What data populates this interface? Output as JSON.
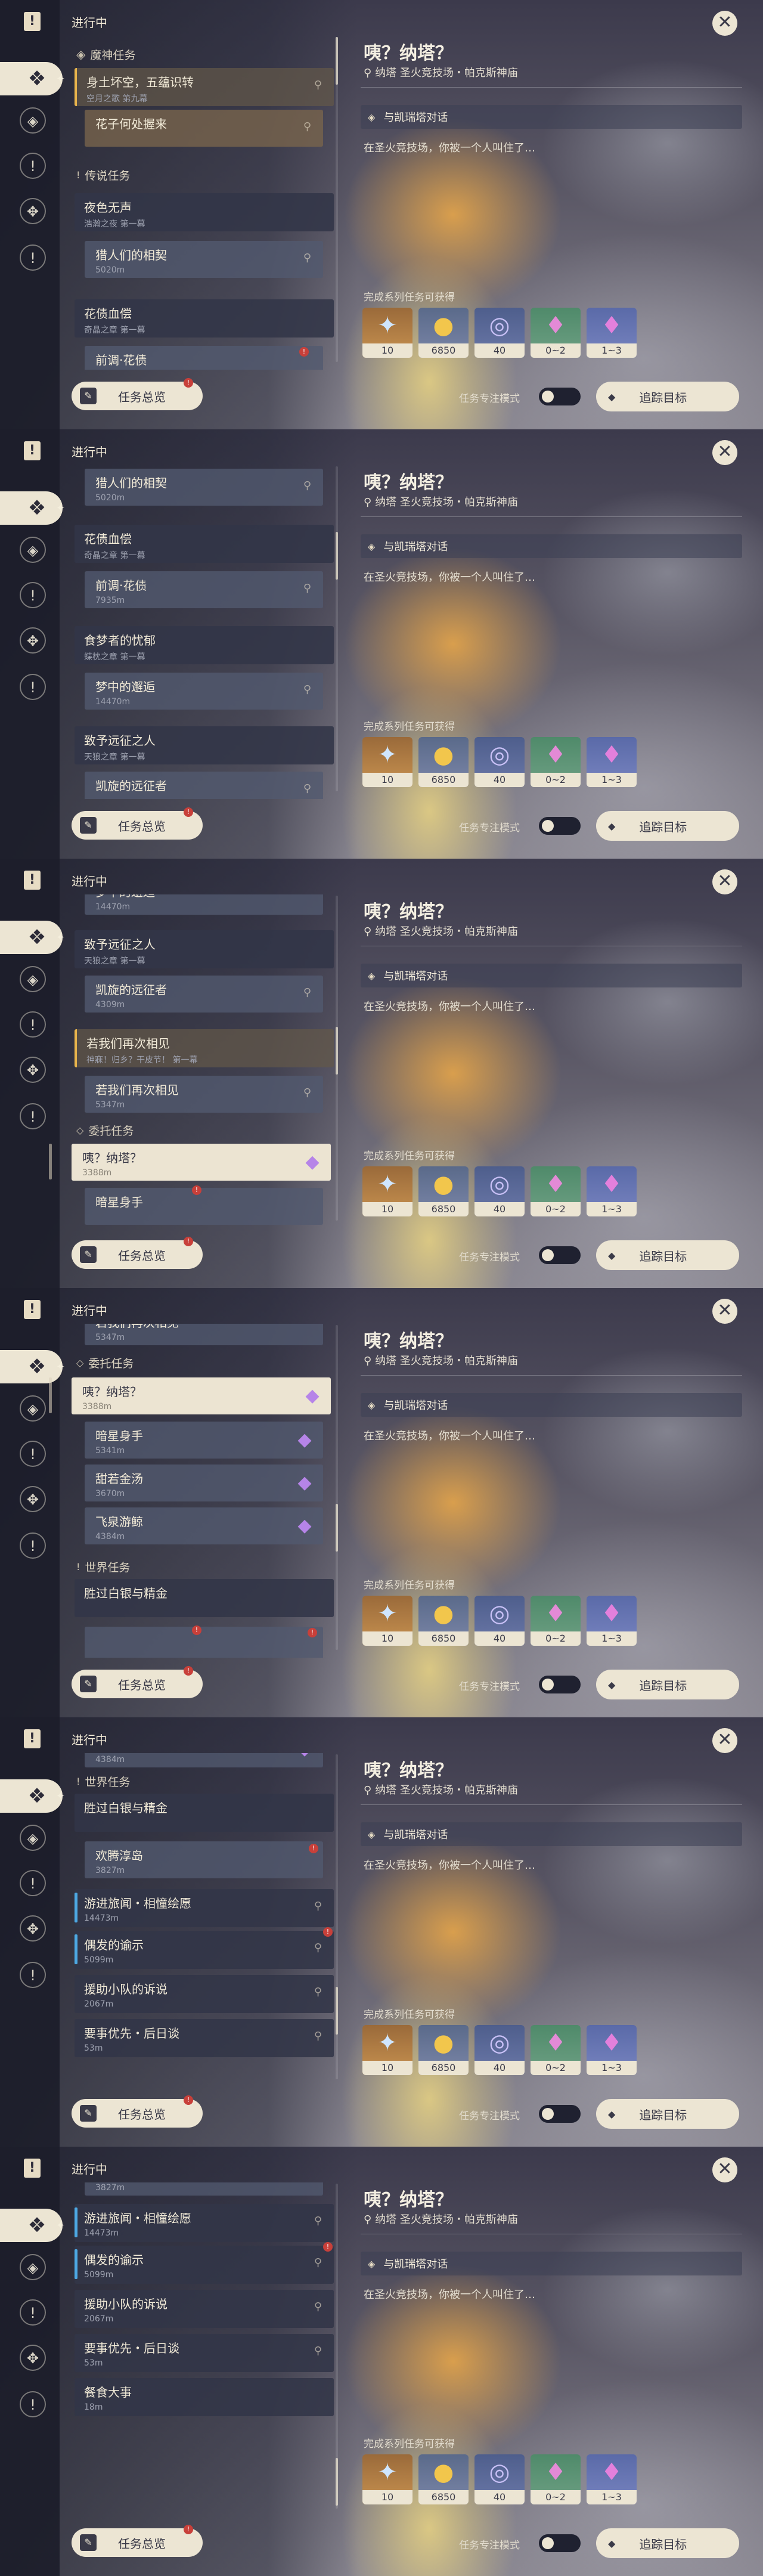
{
  "header": {
    "title": "进行中"
  },
  "icons": {
    "top": "quest-book-icon",
    "rail": [
      "archon-quest-icon",
      "story-quest-icon",
      "world-quest-icon",
      "commission-icon"
    ]
  },
  "sections": {
    "archon": "魔神任务",
    "story": "传说任务",
    "commission": "委托任务",
    "world": "世界任务"
  },
  "quests": {
    "archon_title": "身土坏空，五蕴识转",
    "archon_chapter": "空月之歌 第九幕",
    "archon_sub": "花子何处握来",
    "story1_title": "夜色无声",
    "story1_chapter": "浩瀚之夜 第一幕",
    "story1_sub": "猎人们的相契",
    "story1_dist": "5020m",
    "story2_title": "花债血偿",
    "story2_chapter": "奇晶之章 第一幕",
    "story2_sub": "前调·花债",
    "story2_dist": "7935m",
    "story3_title": "食梦者的忧郁",
    "story3_chapter": "蝶枕之章 第一幕",
    "story3_sub": "梦中的邂逅",
    "story3_dist": "14470m",
    "story4_title": "致予远征之人",
    "story4_chapter": "天狼之章 第一幕",
    "story4_sub": "凯旋的远征者",
    "story4_dist": "4309m",
    "story5_title": "若我们再次相见",
    "story5_chapter": "神寐！归乡？干皮节！ 第一幕",
    "story5_sub": "若我们再次相见",
    "story5_dist": "5347m",
    "comm1_title": "咦？纳塔？",
    "comm1_dist": "3388m",
    "comm2_title": "暗星身手",
    "comm2_dist": "5341m",
    "comm3_title": "甜若金汤",
    "comm3_dist": "3670m",
    "comm4_title": "飞泉游鲸",
    "comm4_dist": "4384m",
    "world1_title": "胜过白银与精金",
    "world_sub1": "欢腾淳岛",
    "world_sub1_dist": "3827m",
    "world2_title": "游进旅闻・相憧绘愿",
    "world2_dist": "14473m",
    "world3_title": "偶发的谕示",
    "world3_dist": "5099m",
    "world4_title": "援助小队的诉说",
    "world4_dist": "2067m",
    "world5_title": "要事优先・后日谈",
    "world5_dist": "53m",
    "world6_title": "餐食大事",
    "world6_dist": "18m"
  },
  "overview": {
    "label": "任务总览",
    "badge": "!"
  },
  "detail": {
    "title": "咦？纳塔？",
    "location": "纳塔 圣火竞技场・帕克斯神庙",
    "objective": "与凯瑞塔对话",
    "description": "在圣火竞技场，你被一个人叫住了…",
    "rewards_header": "完成系列任务可获得",
    "rewards": [
      {
        "icon": "primogem-icon",
        "count": "10"
      },
      {
        "icon": "mora-icon",
        "count": "6850"
      },
      {
        "icon": "adventure-exp-icon",
        "count": "40"
      },
      {
        "icon": "crystal-ore-icon",
        "count": "0~2"
      },
      {
        "icon": "crystal-chunk-icon",
        "count": "1~3"
      }
    ],
    "focus_label": "任务专注模式",
    "track_label": "追踪目标"
  }
}
